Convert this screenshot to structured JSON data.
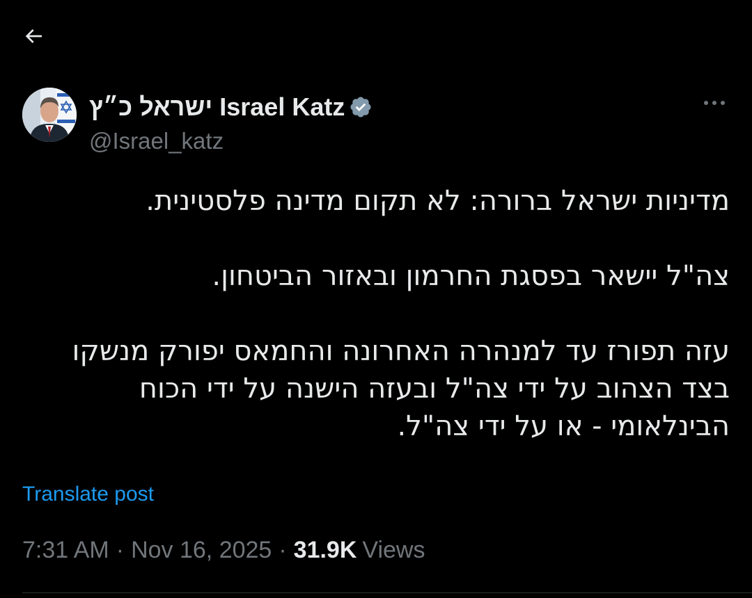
{
  "nav": {
    "back_icon": "arrow-left-icon"
  },
  "author": {
    "display_name": "ישראל כ״ץ Israel Katz",
    "handle": "@Israel_katz",
    "verified_icon": "verified-badge-icon",
    "verified_color": "#829aab"
  },
  "post": {
    "paragraphs": [
      [
        "מדיניות ישראל ברורה: לא תקום מדינה פלסטינית."
      ],
      [
        "צה\"ל יישאר בפסגת החרמון ובאזור הביטחון."
      ],
      [
        "עזה תפורז עד למנהרה האחרונה והחמאס יפורק מנשקו",
        "בצד הצהוב על ידי צה\"ל ובעזה הישנה על ידי הכוח",
        "הבינלאומי - או על ידי צה\"ל."
      ]
    ],
    "translate_label": "Translate post"
  },
  "meta": {
    "time": "7:31 AM",
    "separator": "·",
    "date": "Nov 16, 2025",
    "views_count": "31.9K",
    "views_label": "Views"
  },
  "colors": {
    "background": "#000000",
    "text_primary": "#e7e9ea",
    "text_secondary": "#71767b",
    "link": "#1d9bf0"
  }
}
